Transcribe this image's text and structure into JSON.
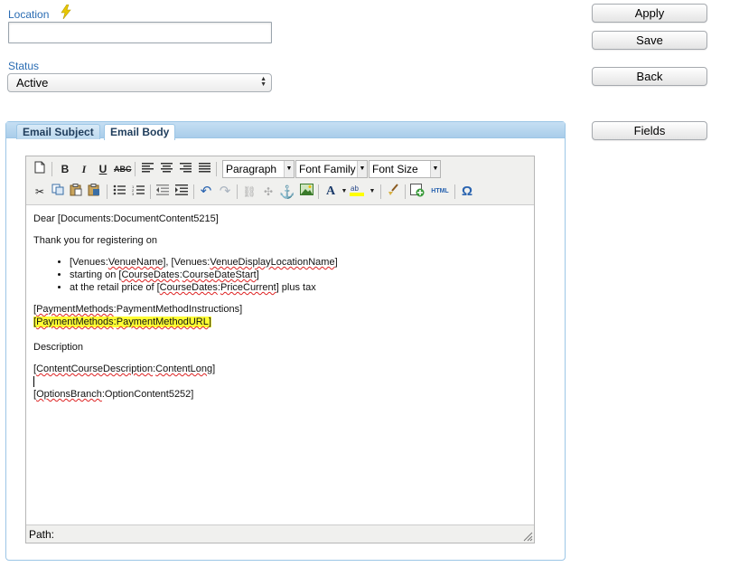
{
  "form": {
    "location_label": "Location",
    "location_value": "",
    "status_label": "Status",
    "status_value": "Active"
  },
  "buttons": {
    "apply": "Apply",
    "save": "Save",
    "back": "Back",
    "fields": "Fields"
  },
  "tabs": [
    {
      "label": "Email Subject",
      "active": false
    },
    {
      "label": "Email Body",
      "active": true
    }
  ],
  "toolbar": {
    "format_select": "Paragraph",
    "font_family_select": "Font Family",
    "font_size_select": "Font Size",
    "icons_row1": [
      "new-document-icon",
      "bold-icon",
      "italic-icon",
      "underline-icon",
      "strikethrough-icon",
      "align-left-icon",
      "align-center-icon",
      "align-right-icon",
      "align-justify-icon"
    ],
    "icons_row2": [
      "cut-icon",
      "copy-icon",
      "paste-icon",
      "paste-word-icon",
      "bullet-list-icon",
      "numbered-list-icon",
      "outdent-icon",
      "indent-icon",
      "undo-icon",
      "redo-icon",
      "link-icon",
      "unlink-icon",
      "anchor-icon",
      "image-icon",
      "font-color-icon",
      "highlight-color-icon",
      "cleanup-icon",
      "insert-field-icon",
      "html-source-icon",
      "special-char-icon"
    ],
    "html_label": "HTML",
    "omega_label": "Ω"
  },
  "email_body": {
    "greeting_a": "Dear [Documents:DocumentContent5215]",
    "intro": "Thank you for registering on",
    "bullet1_a": "[Venues:",
    "bullet1_b": "VenueName",
    "bullet1_c": "], [Venues:",
    "bullet1_d": "VenueDisplayLocationName",
    "bullet1_e": "]",
    "bullet2_a": "starting on [",
    "bullet2_b": "CourseDates",
    "bullet2_c": ":",
    "bullet2_d": "CourseDateStart",
    "bullet2_e": "]",
    "bullet3_a": "at the retail price of [",
    "bullet3_b": "CourseDates",
    "bullet3_c": ":",
    "bullet3_d": "PriceCurrent",
    "bullet3_e": "] plus tax",
    "payment_a": "[",
    "payment_b": "PaymentMethods",
    "payment_c": ":PaymentMethodInstructions]",
    "payment_url_a": "[",
    "payment_url_b": "PaymentMethods",
    "payment_url_c": ":",
    "payment_url_d": "PaymentMethodURL",
    "payment_url_e": "]",
    "description": "Description",
    "course_desc_a": "[",
    "course_desc_b": "ContentCourseDescription",
    "course_desc_c": ":",
    "course_desc_d": "ContentLong",
    "course_desc_e": "]",
    "options_a": "[",
    "options_b": "OptionsBranch",
    "options_c": ":OptionContent5252]"
  },
  "path_label": "Path:",
  "colors": {
    "label_blue": "#2a6cb3",
    "panel_border": "#9cc6e6",
    "highlight": "#ffff33"
  }
}
